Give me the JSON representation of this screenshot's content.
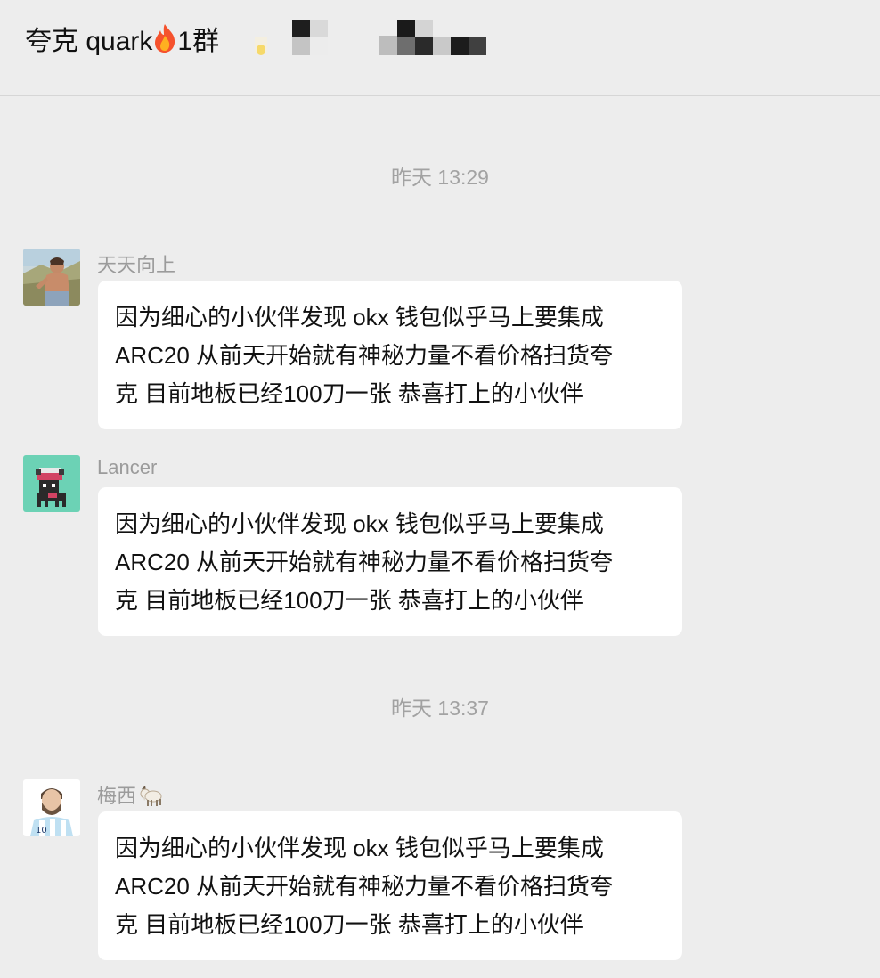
{
  "chat": {
    "title": "夸克 quark",
    "title_suffix": "1群"
  },
  "messages": [
    {
      "type": "timestamp",
      "text": "昨天 13:29"
    },
    {
      "type": "message",
      "sender": "天天向上",
      "avatar": "man-outdoor-avatar",
      "lines": [
        "因为细心的小伙伴发现 okx 钱包似乎马上要集成",
        "ARC20  从前天开始就有神秘力量不看价格扫货夸",
        "克 目前地板已经100刀一张 恭喜打上的小伙伴"
      ]
    },
    {
      "type": "message",
      "sender": "Lancer",
      "avatar": "pixel-llama-avatar",
      "lines": [
        "因为细心的小伙伴发现 okx 钱包似乎马上要集成",
        "ARC20  从前天开始就有神秘力量不看价格扫货夸",
        "克 目前地板已经100刀一张 恭喜打上的小伙伴"
      ]
    },
    {
      "type": "timestamp",
      "text": "昨天 13:37"
    },
    {
      "type": "message",
      "sender": "梅西",
      "avatar": "footballer-avatar",
      "lines": [
        "因为细心的小伙伴发现 okx 钱包似乎马上要集成",
        "ARC20  从前天开始就有神秘力量不看价格扫货夸",
        "克 目前地板已经100刀一张 恭喜打上的小伙伴"
      ]
    }
  ],
  "colors": {
    "background": "#ededed",
    "bubble": "#ffffff",
    "timestamp": "#a2a2a2",
    "sender": "#9b9b9b"
  }
}
